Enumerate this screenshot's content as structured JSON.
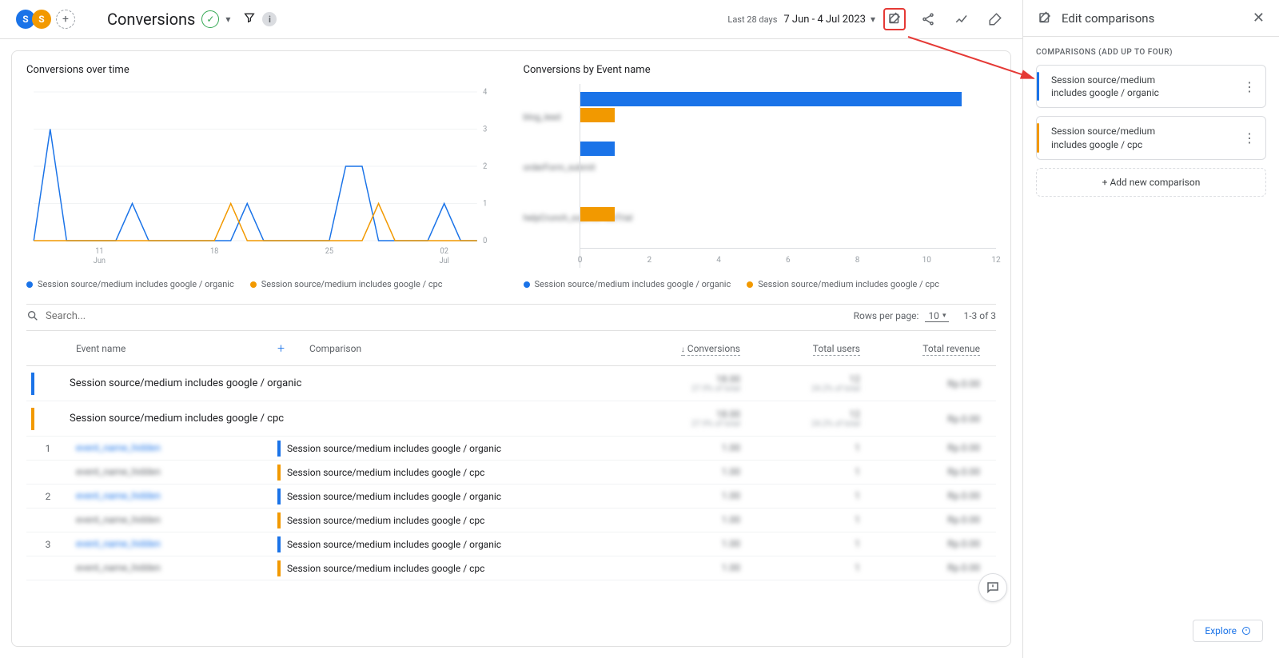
{
  "colors": {
    "blue": "#1a73e8",
    "orange": "#f29900"
  },
  "header": {
    "title": "Conversions",
    "date_caption": "Last 28 days",
    "date_range": "7 Jun - 4 Jul 2023"
  },
  "legend": {
    "series_a": "Session source/medium includes google / organic",
    "series_b": "Session source/medium includes google / cpc"
  },
  "chart_titles": {
    "line": "Conversions over time",
    "bar": "Conversions by Event name"
  },
  "chart_data": [
    {
      "type": "line",
      "title": "Conversions over time",
      "xlabel": "",
      "ylabel": "",
      "ylim": [
        0,
        4
      ],
      "yticks": [
        0,
        1,
        2,
        3,
        4
      ],
      "x_span_days": 28,
      "x_ticks": [
        {
          "day": 4,
          "label": "11",
          "sub": "Jun"
        },
        {
          "day": 11,
          "label": "18",
          "sub": ""
        },
        {
          "day": 18,
          "label": "25",
          "sub": ""
        },
        {
          "day": 25,
          "label": "02",
          "sub": "Jul"
        }
      ],
      "series": [
        {
          "name": "Session source/medium includes google / organic",
          "color": "#1a73e8",
          "values": [
            0,
            3,
            0,
            0,
            0,
            0,
            1,
            0,
            0,
            0,
            0,
            0,
            0,
            1,
            0,
            0,
            0,
            0,
            0,
            2,
            2,
            0,
            0,
            0,
            0,
            1,
            0,
            0
          ]
        },
        {
          "name": "Session source/medium includes google / cpc",
          "color": "#f29900",
          "values": [
            0,
            0,
            0,
            0,
            0,
            0,
            0,
            0,
            0,
            0,
            0,
            0,
            1,
            0,
            0,
            0,
            0,
            0,
            0,
            0,
            0,
            1,
            0,
            0,
            0,
            0,
            0,
            0
          ]
        }
      ]
    },
    {
      "type": "bar",
      "orientation": "horizontal",
      "title": "Conversions by Event name",
      "xlim": [
        0,
        12
      ],
      "xticks": [
        0,
        2,
        4,
        6,
        8,
        10,
        12
      ],
      "categories": [
        "event_1",
        "event_2",
        "event_3"
      ],
      "series": [
        {
          "name": "Session source/medium includes google / organic",
          "color": "#1a73e8",
          "values": [
            11,
            1,
            0
          ]
        },
        {
          "name": "Session source/medium includes google / cpc",
          "color": "#f29900",
          "values": [
            1,
            0,
            1
          ]
        }
      ]
    }
  ],
  "table": {
    "search_placeholder": "Search...",
    "rows_label": "Rows per page:",
    "rows_value": "10",
    "page_info": "1-3 of 3",
    "headers": {
      "event": "Event name",
      "comparison": "Comparison",
      "conversions": "Conversions",
      "users": "Total users",
      "revenue": "Total revenue"
    },
    "summary": [
      {
        "accent": "#1a73e8",
        "label": "Session source/medium includes google / organic"
      },
      {
        "accent": "#f29900",
        "label": "Session source/medium includes google / cpc"
      }
    ],
    "rows": [
      {
        "idx": 1,
        "sub": [
          {
            "accent": "#1a73e8",
            "comp": "Session source/medium includes google / organic"
          },
          {
            "accent": "#f29900",
            "comp": "Session source/medium includes google / cpc"
          }
        ]
      },
      {
        "idx": 2,
        "sub": [
          {
            "accent": "#1a73e8",
            "comp": "Session source/medium includes google / organic"
          },
          {
            "accent": "#f29900",
            "comp": "Session source/medium includes google / cpc"
          }
        ]
      },
      {
        "idx": 3,
        "sub": [
          {
            "accent": "#1a73e8",
            "comp": "Session source/medium includes google / organic"
          },
          {
            "accent": "#f29900",
            "comp": "Session source/medium includes google / cpc"
          }
        ]
      }
    ]
  },
  "side": {
    "title": "Edit comparisons",
    "label": "COMPARISONS (ADD UP TO FOUR)",
    "items": [
      {
        "accent": "#1a73e8",
        "line1": "Session source/medium",
        "line2": "includes google / organic"
      },
      {
        "accent": "#f29900",
        "line1": "Session source/medium",
        "line2": "includes google / cpc"
      }
    ],
    "add_label": "+ Add new comparison"
  },
  "explore_label": "Explore"
}
